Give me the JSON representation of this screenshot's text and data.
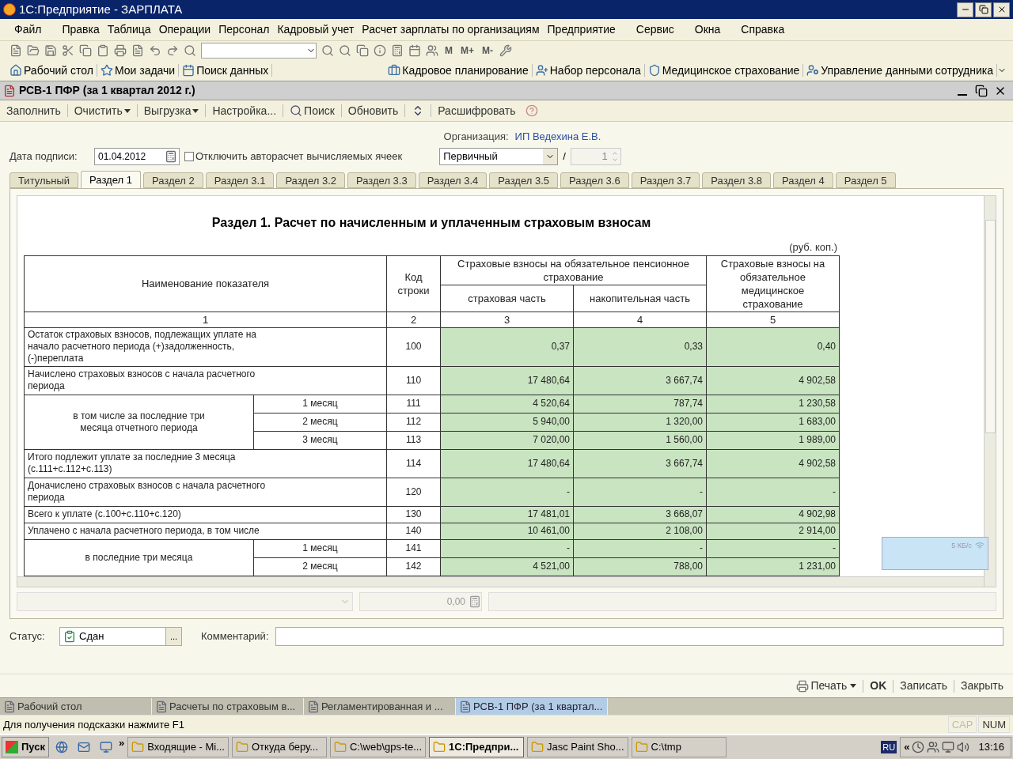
{
  "window": {
    "title": "1С:Предприятие - ЗАРПЛАТА"
  },
  "menu": [
    "Файл",
    "Правка",
    "Таблица",
    "Операции",
    "Персонал",
    "Кадровый учет",
    "Расчет зарплаты по организациям",
    "Предприятие",
    "Сервис",
    "Окна",
    "Справка"
  ],
  "memory_buttons": [
    "M",
    "M+",
    "M-"
  ],
  "panel_links": [
    "Рабочий стол",
    "Мои задачи",
    "Поиск данных",
    "Кадровое планирование",
    "Набор персонала",
    "Медицинское страхование",
    "Управление данными сотрудника"
  ],
  "document": {
    "title": "РСВ-1 ПФР (за 1 квартал 2012 г.)",
    "actions": [
      {
        "kind": "plain",
        "label": "Заполнить",
        "dropdown": false
      },
      {
        "kind": "plain",
        "label": "Очистить",
        "dropdown": true
      },
      {
        "kind": "plain",
        "label": "Выгрузка",
        "dropdown": true
      },
      {
        "kind": "plain",
        "label": "Настройка...",
        "dropdown": false
      },
      {
        "kind": "search",
        "label": "Поиск"
      },
      {
        "kind": "plain",
        "label": "Обновить",
        "dropdown": false
      },
      {
        "kind": "expand"
      },
      {
        "kind": "plain",
        "label": "Расшифровать",
        "dropdown": false
      },
      {
        "kind": "help"
      }
    ]
  },
  "form": {
    "org_label": "Организация:",
    "org_value": "ИП Ведехина Е.В.",
    "date_label": "Дата подписи:",
    "date_value": "01.04.2012",
    "autocalc": {
      "label": "Отключить авторасчет вычисляемых ячеек",
      "checked": false
    },
    "report_type": "Первичный",
    "separator": "/",
    "correction_number": "1"
  },
  "tabs": [
    {
      "label": "Титульный",
      "selected": false
    },
    {
      "label": "Раздел 1",
      "selected": true
    },
    {
      "label": "Раздел 2",
      "selected": false
    },
    {
      "label": "Раздел 3.1",
      "selected": false
    },
    {
      "label": "Раздел 3.2",
      "selected": false
    },
    {
      "label": "Раздел 3.3",
      "selected": false
    },
    {
      "label": "Раздел 3.4",
      "selected": false
    },
    {
      "label": "Раздел 3.5",
      "selected": false
    },
    {
      "label": "Раздел 3.6",
      "selected": false
    },
    {
      "label": "Раздел 3.7",
      "selected": false
    },
    {
      "label": "Раздел 3.8",
      "selected": false
    },
    {
      "label": "Раздел 4",
      "selected": false
    },
    {
      "label": "Раздел 5",
      "selected": false
    }
  ],
  "table": {
    "title": "Раздел 1. Расчет по начисленным и уплаченным страховым взносам",
    "units": "(руб. коп.)",
    "header": {
      "name": "Наименование показателя",
      "code": "Код строки",
      "pension": "Страховые взносы на обязательное пенсионное страхование",
      "pension_insurance": "страховая часть",
      "pension_funded": "накопительная часть",
      "medical": "Страховые взносы на обязательное медицинское страхование"
    },
    "column_numbers": [
      "1",
      "2",
      "3",
      "4",
      "5"
    ],
    "rows": [
      {
        "kind": "single",
        "label": "Остаток страховых взносов, подлежащих уплате на начало расчетного периода (+)задолженность, (-)переплата",
        "code": "100",
        "values": [
          "0,37",
          "0,33",
          "0,40"
        ]
      },
      {
        "kind": "single",
        "label": "Начислено страховых взносов с начала расчетного периода",
        "code": "110",
        "values": [
          "17 480,64",
          "3 667,74",
          "4 902,58"
        ]
      },
      {
        "kind": "group",
        "label": "в том числе за последние три месяца отчетного периода",
        "rows": [
          {
            "label": "1 месяц",
            "code": "111",
            "values": [
              "4 520,64",
              "787,74",
              "1 230,58"
            ]
          },
          {
            "label": "2 месяц",
            "code": "112",
            "values": [
              "5 940,00",
              "1 320,00",
              "1 683,00"
            ]
          },
          {
            "label": "3 месяц",
            "code": "113",
            "values": [
              "7 020,00",
              "1 560,00",
              "1 989,00"
            ]
          }
        ]
      },
      {
        "kind": "single",
        "label": "Итого подлежит уплате за последние 3 месяца (с.111+с.112+с.113)",
        "code": "114",
        "values": [
          "17 480,64",
          "3 667,74",
          "4 902,58"
        ]
      },
      {
        "kind": "single",
        "label": "Доначислено страховых взносов с начала расчетного периода",
        "code": "120",
        "values": [
          "-",
          "-",
          "-"
        ]
      },
      {
        "kind": "single",
        "label": "Всего к уплате (с.100+с.110+с.120)",
        "code": "130",
        "values": [
          "17 481,01",
          "3 668,07",
          "4 902,98"
        ]
      },
      {
        "kind": "single",
        "label": "Уплачено с начала расчетного периода, в том числе",
        "code": "140",
        "values": [
          "10 461,00",
          "2 108,00",
          "2 914,00"
        ]
      },
      {
        "kind": "group",
        "label": "в последние три месяца",
        "rows": [
          {
            "label": "1 месяц",
            "code": "141",
            "values": [
              "-",
              "-",
              "-"
            ]
          },
          {
            "label": "2 месяц",
            "code": "142",
            "values": [
              "4 521,00",
              "788,00",
              "1 231,00"
            ]
          }
        ]
      }
    ]
  },
  "cell_editor": {
    "value": "0,00"
  },
  "status": {
    "label": "Статус:",
    "value": "Сдан",
    "choose_button": "...",
    "comment_label": "Комментарий:"
  },
  "footer_buttons": [
    {
      "label": "Печать",
      "kind": "print"
    },
    {
      "label": "OK",
      "kind": "default"
    },
    {
      "label": "Записать",
      "kind": "plain"
    },
    {
      "label": "Закрыть",
      "kind": "plain"
    }
  ],
  "window_tabs": [
    {
      "label": "Рабочий стол",
      "selected": false
    },
    {
      "label": "Расчеты по страховым в...",
      "selected": false
    },
    {
      "label": "Регламентированная и ...",
      "selected": false
    },
    {
      "label": "РСВ-1 ПФР (за 1 квартал...",
      "selected": true
    }
  ],
  "status_bar": {
    "hint": "Для получения подсказки нажмите F1",
    "indicators": [
      {
        "label": "CAP",
        "on": false
      },
      {
        "label": "NUM",
        "on": true
      }
    ]
  },
  "network_widget": {
    "speed": "5 КБ/с"
  },
  "taskbar": {
    "start": "Пуск",
    "more": "»",
    "tasks": [
      {
        "label": "Входящие - Mi...",
        "selected": false
      },
      {
        "label": "Откуда беру...",
        "selected": false
      },
      {
        "label": "C:\\web\\gps-te...",
        "selected": false
      },
      {
        "label": "1С:Предпри...",
        "selected": true
      },
      {
        "label": "Jasc Paint Sho...",
        "selected": false
      },
      {
        "label": "C:\\tmp",
        "selected": false
      }
    ],
    "language": "RU",
    "tray_more": "«",
    "time": "13:16"
  }
}
